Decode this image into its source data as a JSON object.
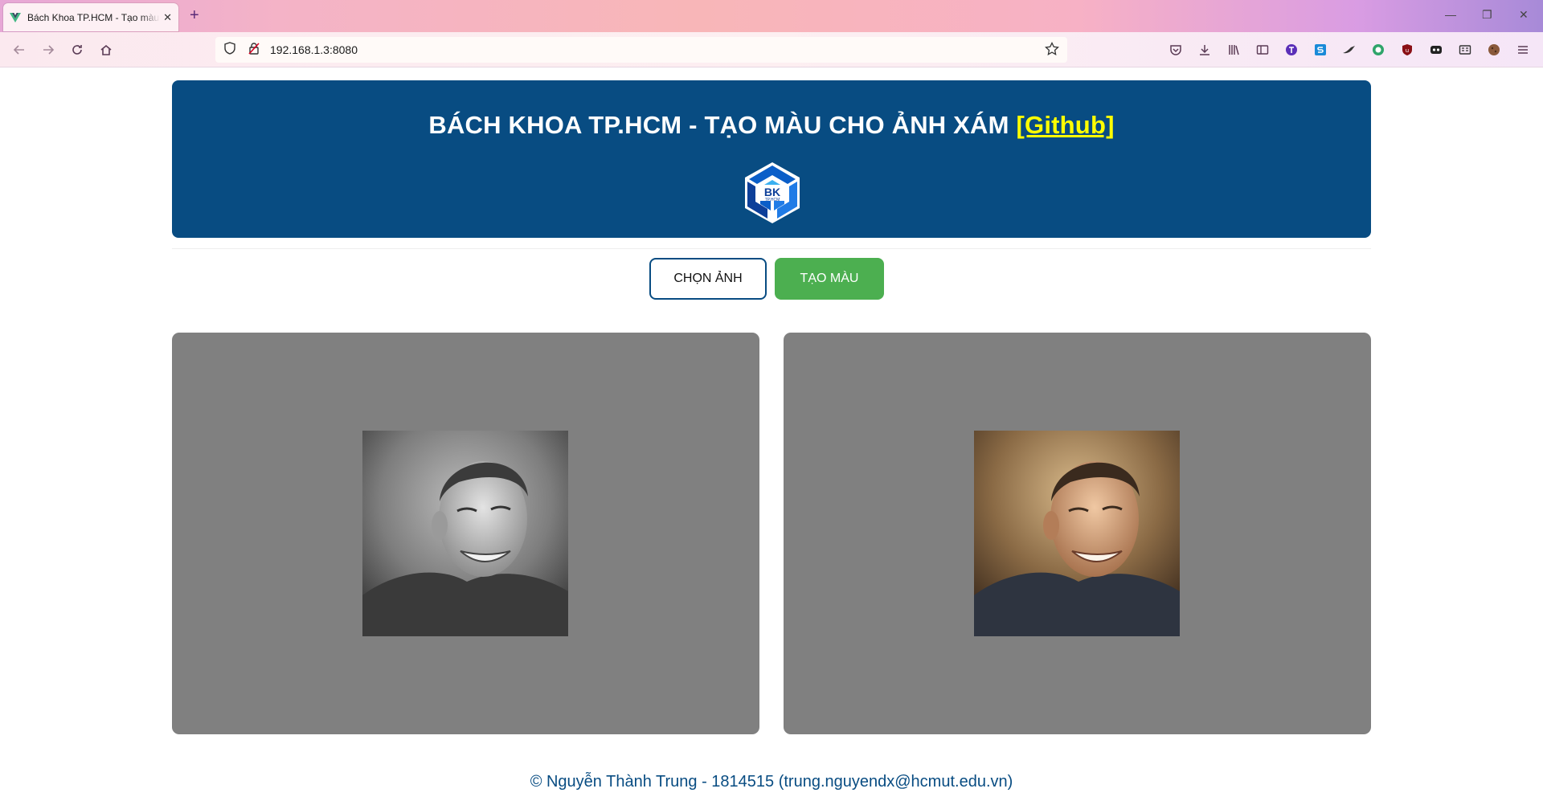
{
  "browser": {
    "tab_title": "Bách Khoa TP.HCM - Tạo màu cho ảnh xám",
    "new_tab": "+",
    "url": "192.168.1.3:8080",
    "win_min": "—",
    "win_restore": "❐",
    "win_close": "✕"
  },
  "header": {
    "title": "BÁCH KHOA TP.HCM - TẠO MÀU CHO ẢNH XÁM",
    "github_link": "[Github]",
    "logo_text": "BK",
    "logo_subtext": "TP.HCM"
  },
  "actions": {
    "choose_label": "CHỌN ẢNH",
    "colorize_label": "TẠO MÀU"
  },
  "footer": {
    "text": "© Nguyễn Thành Trung - 1814515 (trung.nguyendx@hcmut.edu.vn)"
  },
  "colors": {
    "brand_blue": "#084c82",
    "accent_green": "#4caf50",
    "link_yellow": "#ffff00",
    "panel_gray": "#808080"
  },
  "icons": [
    "vue-favicon",
    "back-icon",
    "forward-icon",
    "reload-icon",
    "home-icon",
    "shield-icon",
    "lock-icon",
    "star-icon",
    "pocket-icon",
    "download-icon",
    "library-icon",
    "sidebar-icon"
  ]
}
